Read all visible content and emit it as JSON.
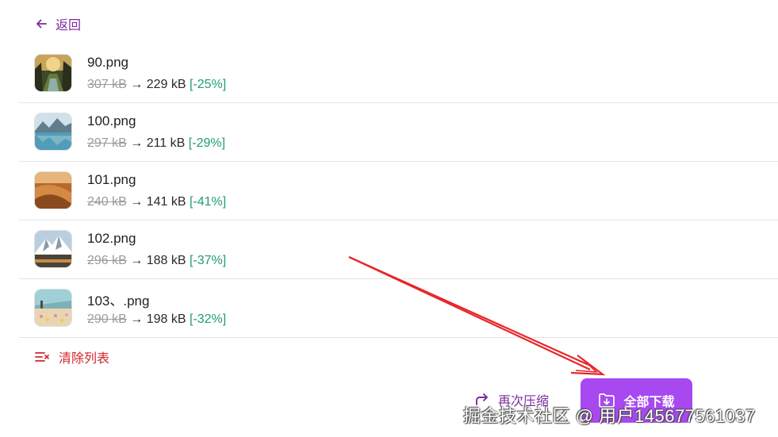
{
  "back": {
    "label": "返回"
  },
  "files": [
    {
      "name": "90.png",
      "old_size": "307 kB",
      "arrow": "→",
      "new_size": "229 kB",
      "pct": "[-25%]",
      "thumb": "forest"
    },
    {
      "name": "100.png",
      "old_size": "297 kB",
      "arrow": "→",
      "new_size": "211 kB",
      "pct": "[-29%]",
      "thumb": "lake"
    },
    {
      "name": "101.png",
      "old_size": "240 kB",
      "arrow": "→",
      "new_size": "141 kB",
      "pct": "[-41%]",
      "thumb": "desert"
    },
    {
      "name": "102.png",
      "old_size": "296 kB",
      "arrow": "→",
      "new_size": "188 kB",
      "pct": "[-37%]",
      "thumb": "mountain"
    },
    {
      "name": "103、.png",
      "old_size": "290 kB",
      "arrow": "→",
      "new_size": "198 kB",
      "pct": "[-32%]",
      "thumb": "meadow"
    }
  ],
  "clear": {
    "label": "清除列表"
  },
  "actions": {
    "recompress_label": "再次压缩",
    "download_all_label": "全部下载"
  },
  "watermark": {
    "text": "掘金技术社区 @ 用户145677561037"
  },
  "colors": {
    "accent": "#7b2b9e",
    "button": "#a848f0",
    "danger": "#d2252c",
    "saving": "#1f9e6e",
    "annotation_arrow": "#e8262a"
  }
}
